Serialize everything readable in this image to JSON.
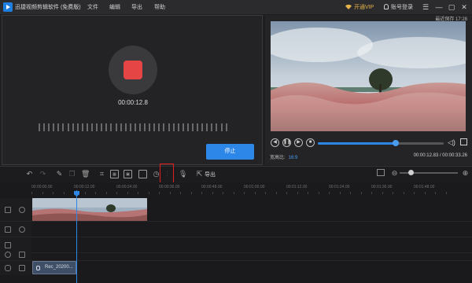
{
  "app": {
    "title": "迅捷视频剪辑软件 (免费版)",
    "menu": [
      "文件",
      "编辑",
      "导出",
      "帮助"
    ],
    "vip_label": "开通VIP",
    "login_label": "账号登录",
    "window_buttons": [
      "menu-icon",
      "minimize-icon",
      "maximize-icon",
      "close-icon"
    ]
  },
  "recorder": {
    "elapsed": "00:00:12.8",
    "stop_label": "停止"
  },
  "preview": {
    "autosave_text": "最近保存 17:28",
    "aspect_label": "宽高比:",
    "aspect_value": "16:9",
    "current_time": "00:00:12.83",
    "duration": "00:00:33.26",
    "progress_fraction": 0.62
  },
  "toolbar": {
    "export_label": "导出",
    "tools": [
      "undo-icon",
      "redo-icon",
      "edit-icon",
      "copy-icon",
      "delete-icon",
      "crop-icon",
      "mosaic-icon",
      "picture-in-picture-icon",
      "freeze-frame-icon",
      "speed-icon",
      "split-icon",
      "voice-record-icon",
      "export-icon"
    ],
    "highlighted_tool": "split-icon"
  },
  "timeline": {
    "ruler_labels": [
      "00:00:00.00",
      "00:00:12.00",
      "00:00:24.00",
      "00:00:36.00",
      "00:00:48.00",
      "00:01:00.00",
      "00:01:12.00",
      "00:01:24.00",
      "00:01:36.00",
      "00:01:48.00"
    ],
    "audio_clip_label": "Rec_20200..."
  },
  "colors": {
    "accent": "#2d87e8",
    "record": "#e64545",
    "vip": "#e6b24a",
    "highlight": "#e01e1e"
  }
}
